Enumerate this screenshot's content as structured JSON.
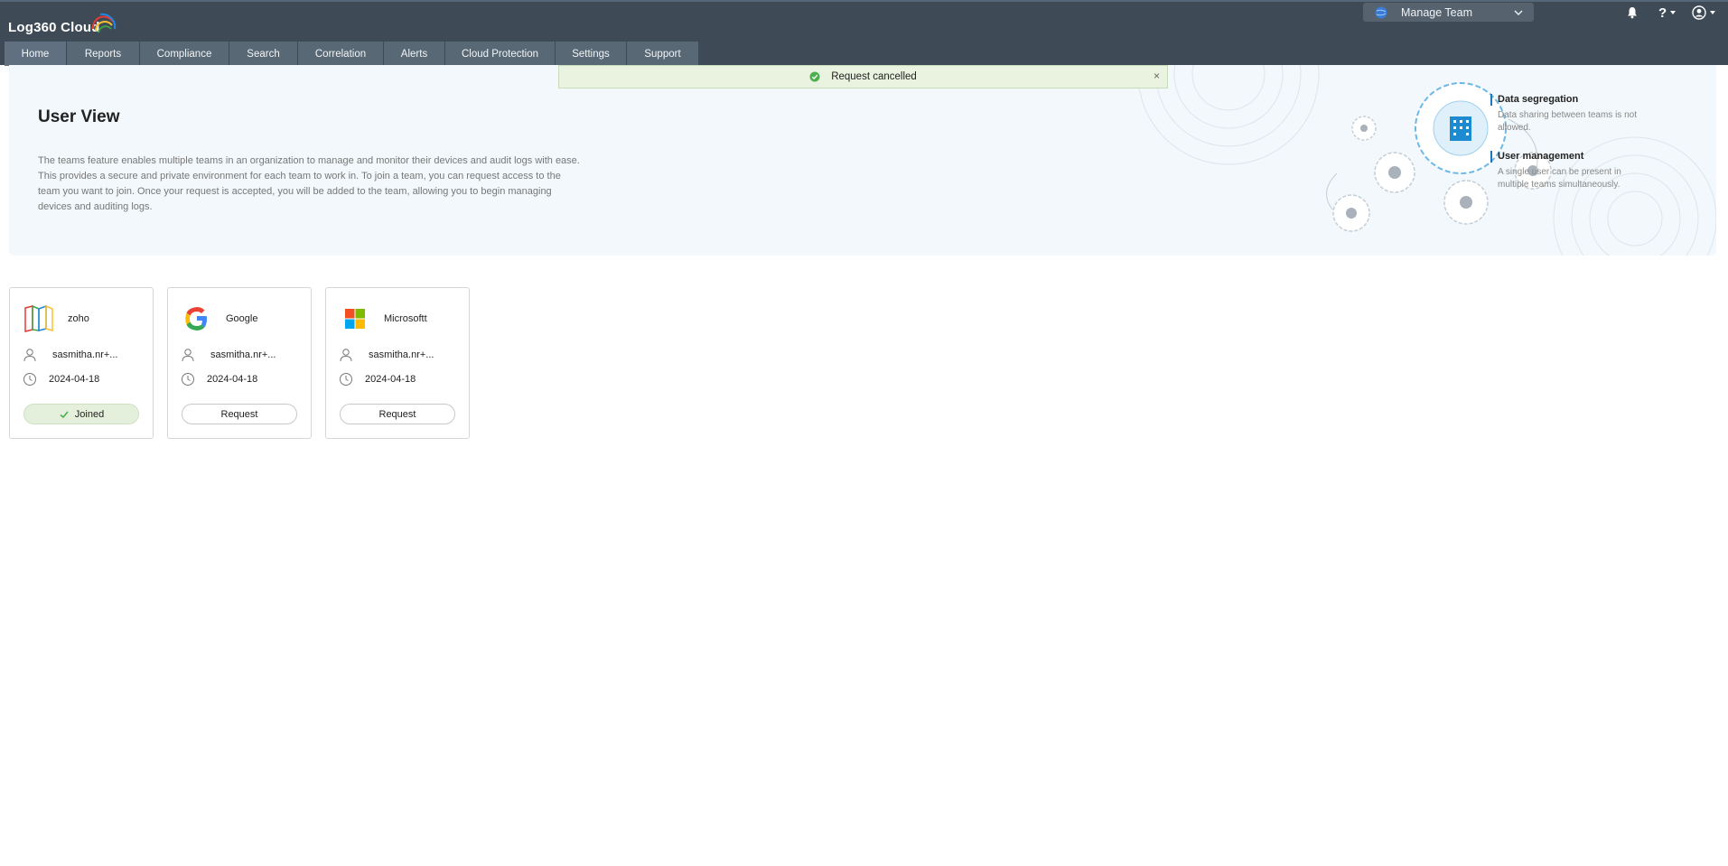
{
  "app": {
    "logo_text": "Log360  Cloud"
  },
  "header": {
    "team_selector": {
      "label": "Manage Team"
    },
    "icons": [
      "bell-icon",
      "help-icon",
      "user-icon"
    ]
  },
  "nav": {
    "items": [
      {
        "label": "Home"
      },
      {
        "label": "Reports"
      },
      {
        "label": "Compliance"
      },
      {
        "label": "Search"
      },
      {
        "label": "Correlation"
      },
      {
        "label": "Alerts"
      },
      {
        "label": "Cloud Protection"
      },
      {
        "label": "Settings"
      },
      {
        "label": "Support"
      }
    ]
  },
  "toast": {
    "message": "Request cancelled",
    "close": "×"
  },
  "hero": {
    "title": "User View",
    "description": "The teams feature enables multiple teams in an organization to manage and monitor their devices and audit logs with ease. This provides a secure and private environment for each team to work in. To join a team, you can request access to the team you want to join. Once your request is accepted, you will be added to the team, allowing you to begin managing devices and auditing logs.",
    "features": [
      {
        "title": "Data segregation",
        "desc": "Data sharing between teams is not allowed."
      },
      {
        "title": "User management",
        "desc": "A single user can be present in multiple teams simultaneously."
      }
    ]
  },
  "teams": [
    {
      "name": "zoho",
      "owner": "sasmitha.nr+...",
      "date": "2024-04-18",
      "action": "Joined",
      "logo": "zoho-logo"
    },
    {
      "name": "Google",
      "owner": "sasmitha.nr+...",
      "date": "2024-04-18",
      "action": "Request",
      "logo": "google-logo"
    },
    {
      "name": "Microsoftt",
      "owner": "sasmitha.nr+...",
      "date": "2024-04-18",
      "action": "Request",
      "logo": "microsoft-logo"
    }
  ],
  "colors": {
    "topbar": "#3e4a56",
    "nav_item": "#586875",
    "hero_bg": "#f2f8fb",
    "accent": "#1d78c1",
    "toast_bg": "#e9f3e0",
    "joined_bg": "#e5f0dc"
  }
}
